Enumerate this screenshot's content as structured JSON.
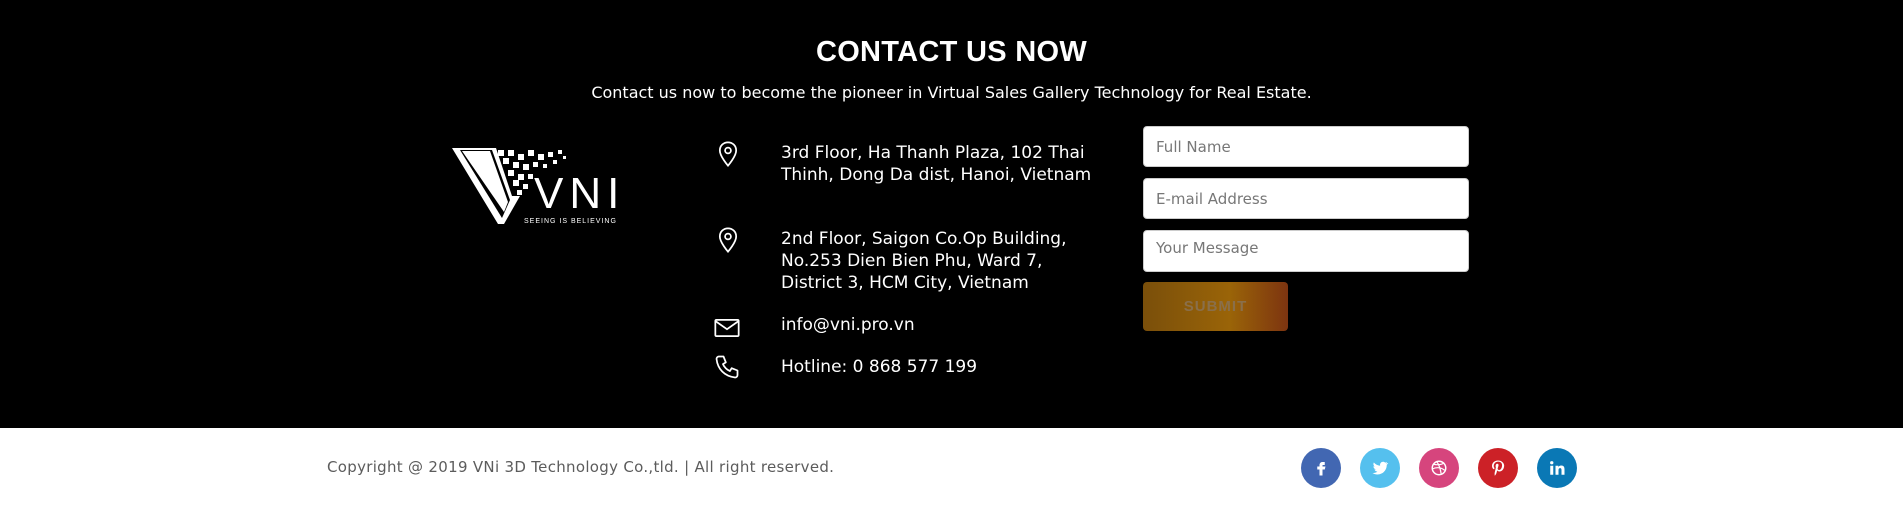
{
  "contact": {
    "title": "CONTACT US NOW",
    "subtitle": "Contact us now to become the pioneer in Virtual Sales Gallery Technology for Real Estate.",
    "logo": {
      "text": "VNI",
      "tagline": "SEEING IS BELIEVING"
    },
    "info": [
      {
        "icon": "location-pin-icon",
        "text": "3rd Floor, Ha Thanh Plaza, 102 Thai Thinh, Dong Da dist, Hanoi, Vietnam"
      },
      {
        "icon": "location-pin-icon",
        "text": "2nd Floor, Saigon Co.Op Building, No.253 Dien Bien Phu, Ward 7, District 3, HCM City, Vietnam"
      },
      {
        "icon": "envelope-icon",
        "text": "info@vni.pro.vn"
      },
      {
        "icon": "phone-icon",
        "text": "Hotline: 0 868 577 199"
      }
    ],
    "form": {
      "name_placeholder": "Full Name",
      "email_placeholder": "E-mail Address",
      "message_placeholder": "Your Message",
      "submit_label": "SUBMIT"
    }
  },
  "footer": {
    "copyright": "Copyright @ 2019 VNi 3D Technology Co.,tld. | All right reserved.",
    "social": [
      {
        "icon": "facebook-icon",
        "color": "#4267b2"
      },
      {
        "icon": "twitter-icon",
        "color": "#55c0ee"
      },
      {
        "icon": "dribbble-icon",
        "color": "#d6457d"
      },
      {
        "icon": "pinterest-icon",
        "color": "#cc2127"
      },
      {
        "icon": "linkedin-icon",
        "color": "#0a78b5"
      }
    ]
  }
}
